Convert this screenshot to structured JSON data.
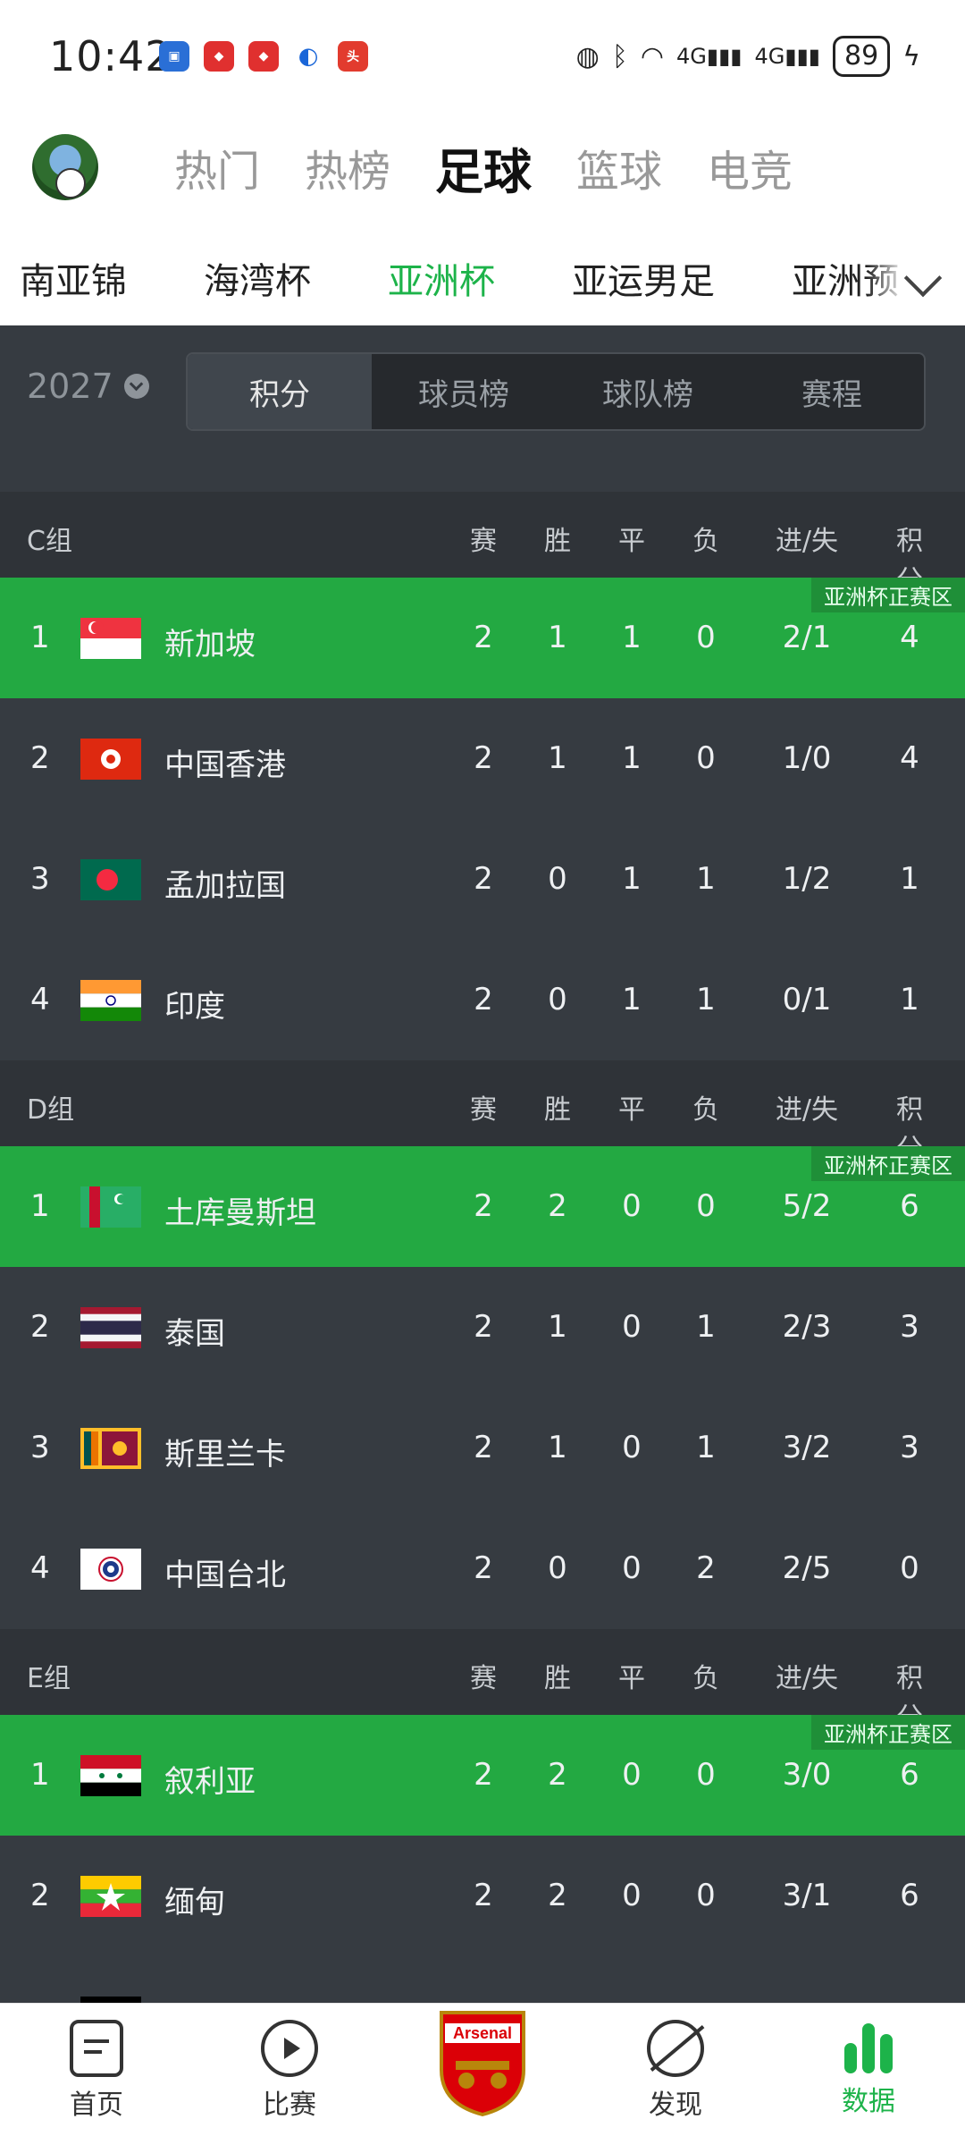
{
  "status_bar": {
    "time": "10:42",
    "battery": "89"
  },
  "top_tabs": [
    "热门",
    "热榜",
    "足球",
    "篮球",
    "电竞"
  ],
  "top_tabs_active": "足球",
  "comp_tabs": [
    "南亚锦",
    "海湾杯",
    "亚洲杯",
    "亚运男足",
    "亚洲预"
  ],
  "comp_tabs_active": "亚洲杯",
  "filter": {
    "year": "2027",
    "segments": [
      "积分",
      "球员榜",
      "球队榜",
      "赛程"
    ],
    "active": "积分"
  },
  "columns": [
    "赛",
    "胜",
    "平",
    "负",
    "进/失",
    "积分"
  ],
  "promo_label": "亚洲杯正赛区",
  "groups": [
    {
      "name": "C组",
      "rows": [
        {
          "rank": "1",
          "team": "新加坡",
          "flag": "singapore",
          "p": "2",
          "w": "1",
          "d": "1",
          "l": "0",
          "gd": "2/1",
          "pts": "4",
          "promo": true
        },
        {
          "rank": "2",
          "team": "中国香港",
          "flag": "hongkong",
          "p": "2",
          "w": "1",
          "d": "1",
          "l": "0",
          "gd": "1/0",
          "pts": "4",
          "promo": false
        },
        {
          "rank": "3",
          "team": "孟加拉国",
          "flag": "bangladesh",
          "p": "2",
          "w": "0",
          "d": "1",
          "l": "1",
          "gd": "1/2",
          "pts": "1",
          "promo": false
        },
        {
          "rank": "4",
          "team": "印度",
          "flag": "india",
          "p": "2",
          "w": "0",
          "d": "1",
          "l": "1",
          "gd": "0/1",
          "pts": "1",
          "promo": false
        }
      ]
    },
    {
      "name": "D组",
      "rows": [
        {
          "rank": "1",
          "team": "土库曼斯坦",
          "flag": "turkmenistan",
          "p": "2",
          "w": "2",
          "d": "0",
          "l": "0",
          "gd": "5/2",
          "pts": "6",
          "promo": true
        },
        {
          "rank": "2",
          "team": "泰国",
          "flag": "thailand",
          "p": "2",
          "w": "1",
          "d": "0",
          "l": "1",
          "gd": "2/3",
          "pts": "3",
          "promo": false
        },
        {
          "rank": "3",
          "team": "斯里兰卡",
          "flag": "srilanka",
          "p": "2",
          "w": "1",
          "d": "0",
          "l": "1",
          "gd": "3/2",
          "pts": "3",
          "promo": false
        },
        {
          "rank": "4",
          "team": "中国台北",
          "flag": "taipei",
          "p": "2",
          "w": "0",
          "d": "0",
          "l": "2",
          "gd": "2/5",
          "pts": "0",
          "promo": false
        }
      ]
    },
    {
      "name": "E组",
      "rows": [
        {
          "rank": "1",
          "team": "叙利亚",
          "flag": "syria",
          "p": "2",
          "w": "2",
          "d": "0",
          "l": "0",
          "gd": "3/0",
          "pts": "6",
          "promo": true
        },
        {
          "rank": "2",
          "team": "缅甸",
          "flag": "myanmar",
          "p": "2",
          "w": "2",
          "d": "0",
          "l": "0",
          "gd": "3/1",
          "pts": "6",
          "promo": false
        }
      ]
    }
  ],
  "bottom_nav": [
    {
      "label": "首页",
      "icon": "document-icon"
    },
    {
      "label": "比赛",
      "icon": "play-icon"
    },
    {
      "label": "",
      "icon": "arsenal-crest-icon"
    },
    {
      "label": "发现",
      "icon": "discover-icon"
    },
    {
      "label": "数据",
      "icon": "bar-chart-icon"
    }
  ],
  "bottom_nav_active": "数据",
  "colors": {
    "accent": "#1db34a",
    "dark_bg": "#363b41",
    "promo_row": "#23a942"
  },
  "crest_text": "Arsenal"
}
